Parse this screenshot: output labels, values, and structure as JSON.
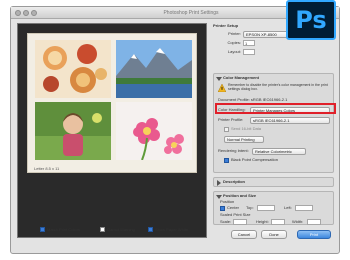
{
  "window": {
    "title": "Photoshop Print Settings"
  },
  "photoshop_logo": {
    "text": "Ps",
    "brand_color": "#31a8ff",
    "background": "#001d34"
  },
  "preview": {
    "paper_size_label": "Letter 8.5 x 11",
    "photos": [
      "food-and-desserts",
      "mountain-lake",
      "child-portrait",
      "pink-flowers"
    ],
    "checkboxes": [
      {
        "label": "Match Print Colors",
        "checked": true
      },
      {
        "label": "Gamut Warning",
        "checked": false
      },
      {
        "label": "Show Paper White",
        "checked": true
      }
    ]
  },
  "printer_setup": {
    "header": "Printer Setup",
    "printer_label": "Printer:",
    "printer_value": "EPSON XP-8500",
    "copies_label": "Copies:",
    "copies_value": "1",
    "layout_label": "Layout:"
  },
  "color_management": {
    "header": "Color Management",
    "warning": "Remember to disable the printer's color management in the print settings dialog box.",
    "document_profile": "Document Profile: sRGB IEC61966-2.1",
    "color_handling_label": "Color Handling:",
    "color_handling_value": "Printer Manages Colors",
    "printer_profile_label": "Printer Profile:",
    "printer_profile_value": "sRGB IEC61966-2.1",
    "send_16bit_label": "Send 16-bit Data",
    "normal_printing_value": "Normal Printing",
    "rendering_intent_label": "Rendering Intent:",
    "rendering_intent_value": "Relative Colorimetric",
    "black_point_label": "Black Point Compensation",
    "black_point_checked": true
  },
  "description": {
    "header": "Description"
  },
  "position_size": {
    "header": "Position and Size",
    "position_label": "Position",
    "center_label": "Center",
    "top_label": "Top:",
    "left_label": "Left:",
    "scaled_label": "Scaled Print Size",
    "scale_label": "Scale:",
    "height_label": "Height:",
    "width_label": "Width:"
  },
  "buttons": {
    "cancel": "Cancel",
    "done": "Done",
    "print": "Print"
  },
  "colors": {
    "highlight_red": "#e0202a",
    "primary_blue": "#3d87de"
  }
}
